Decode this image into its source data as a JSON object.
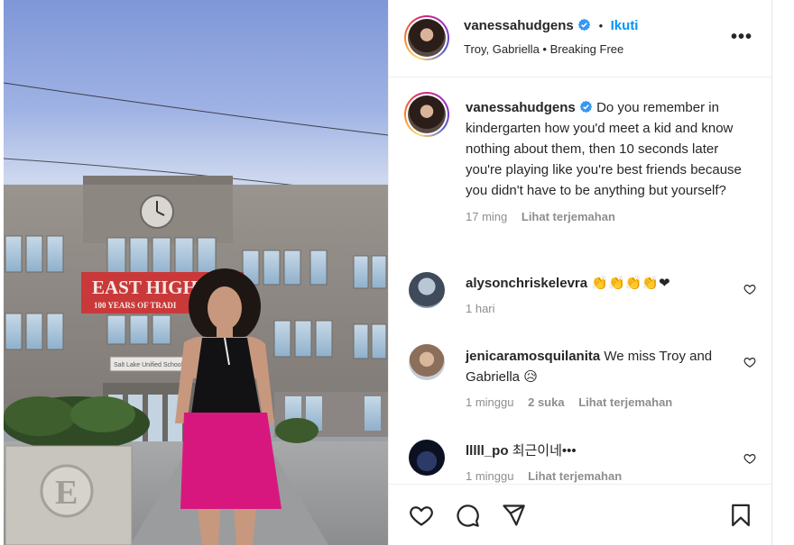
{
  "post_header": {
    "username": "vanessahudgens",
    "separator": "•",
    "follow_label": "Ikuti",
    "subtitle": "Troy, Gabriella • Breaking Free",
    "more_label": "•••"
  },
  "media": {
    "building_sign": "EAST HIGH",
    "sign_sub": "100 YEARS OF TRADI",
    "plaque_text": "Salt Lake Unified Schools",
    "monument_letter": "E"
  },
  "caption": {
    "username": "vanessahudgens",
    "text": "Do you remember in kindergarten how you'd meet a kid and know nothing about them, then 10 seconds later you're playing like you're best friends because you didn't have to be anything but yourself?",
    "time": "17 ming",
    "translate_label": "Lihat terjemahan"
  },
  "comments": [
    {
      "username": "alysonchriskelevra",
      "text": "👏👏👏👏❤",
      "time": "1 hari",
      "likes": "",
      "translate": ""
    },
    {
      "username": "jenicaramosquilanita",
      "text": "We miss Troy and Gabriella 😥",
      "time": "1 minggu",
      "likes": "2 suka",
      "translate": "Lihat terjemahan"
    },
    {
      "username": "lllll_po",
      "text": "최근이네•••",
      "time": "1 minggu",
      "likes": "",
      "translate": "Lihat terjemahan"
    }
  ],
  "icons": {
    "like": "heart-icon",
    "comment": "comment-icon",
    "share": "paper-plane-icon",
    "save": "bookmark-icon",
    "verified": "verified-badge-icon"
  },
  "colors": {
    "link_blue": "#0095f6",
    "verified_blue": "#3897f0",
    "muted": "#8e8e8e",
    "sign_red": "#c9393a",
    "skirt_pink": "#d8177e"
  }
}
